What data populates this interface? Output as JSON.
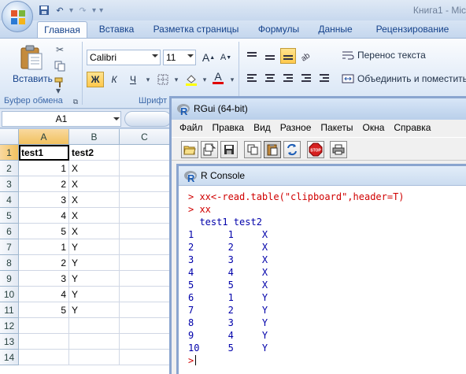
{
  "excel": {
    "title_text": "Книга1 - Mic",
    "tabs": [
      {
        "label": "Главная",
        "active": true
      },
      {
        "label": "Вставка"
      },
      {
        "label": "Разметка страницы"
      },
      {
        "label": "Формулы"
      },
      {
        "label": "Данные"
      },
      {
        "label": "Рецензирование"
      }
    ],
    "ribbon": {
      "paste_label": "Вставить",
      "clipboard_group_label": "Буфер обмена",
      "font_group_label": "Шрифт",
      "font_name": "Calibri",
      "font_size": "11",
      "grow_font": "A",
      "shrink_font": "A",
      "bold": "Ж",
      "italic": "К",
      "underline": "Ч",
      "font_color_letter": "A",
      "wrap_text_label": "Перенос текста",
      "merge_label": "Объединить и поместить"
    },
    "name_box": "A1",
    "columns": [
      "A",
      "B",
      "C"
    ],
    "rows": [
      "1",
      "2",
      "3",
      "4",
      "5",
      "6",
      "7",
      "8",
      "9",
      "10",
      "11",
      "12",
      "13",
      "14"
    ],
    "cells": [
      [
        "test1",
        "test2"
      ],
      [
        "1",
        "X"
      ],
      [
        "2",
        "X"
      ],
      [
        "3",
        "X"
      ],
      [
        "4",
        "X"
      ],
      [
        "5",
        "X"
      ],
      [
        "1",
        "Y"
      ],
      [
        "2",
        "Y"
      ],
      [
        "3",
        "Y"
      ],
      [
        "4",
        "Y"
      ],
      [
        "5",
        "Y"
      ]
    ]
  },
  "rgui": {
    "title": "RGui (64-bit)",
    "menu": [
      "Файл",
      "Правка",
      "Вид",
      "Разное",
      "Пакеты",
      "Окна",
      "Справка"
    ],
    "toolbar_icons": [
      "open-script-icon",
      "load-workspace-icon",
      "save-icon",
      "copy-icon",
      "paste-icon",
      "copy-paste-icon",
      "stop-icon",
      "print-icon"
    ],
    "stop_label": "STOP",
    "console_title": "R Console",
    "console_lines": [
      {
        "text": "> xx<-read.table(\"clipboard\",header=T)",
        "kind": "input"
      },
      {
        "text": "> xx",
        "kind": "input"
      },
      {
        "text": "  test1 test2",
        "kind": "output"
      },
      {
        "text": "1      1     X",
        "kind": "output"
      },
      {
        "text": "2      2     X",
        "kind": "output"
      },
      {
        "text": "3      3     X",
        "kind": "output"
      },
      {
        "text": "4      4     X",
        "kind": "output"
      },
      {
        "text": "5      5     X",
        "kind": "output"
      },
      {
        "text": "6      1     Y",
        "kind": "output"
      },
      {
        "text": "7      2     Y",
        "kind": "output"
      },
      {
        "text": "8      3     Y",
        "kind": "output"
      },
      {
        "text": "9      4     Y",
        "kind": "output"
      },
      {
        "text": "10     5     Y",
        "kind": "output"
      }
    ],
    "prompt": ">"
  },
  "colors": {
    "input_red": "#d00000",
    "output_blue": "#0000aa",
    "ribbon_text": "#15428b",
    "selection_orange": "#f1c15f"
  }
}
